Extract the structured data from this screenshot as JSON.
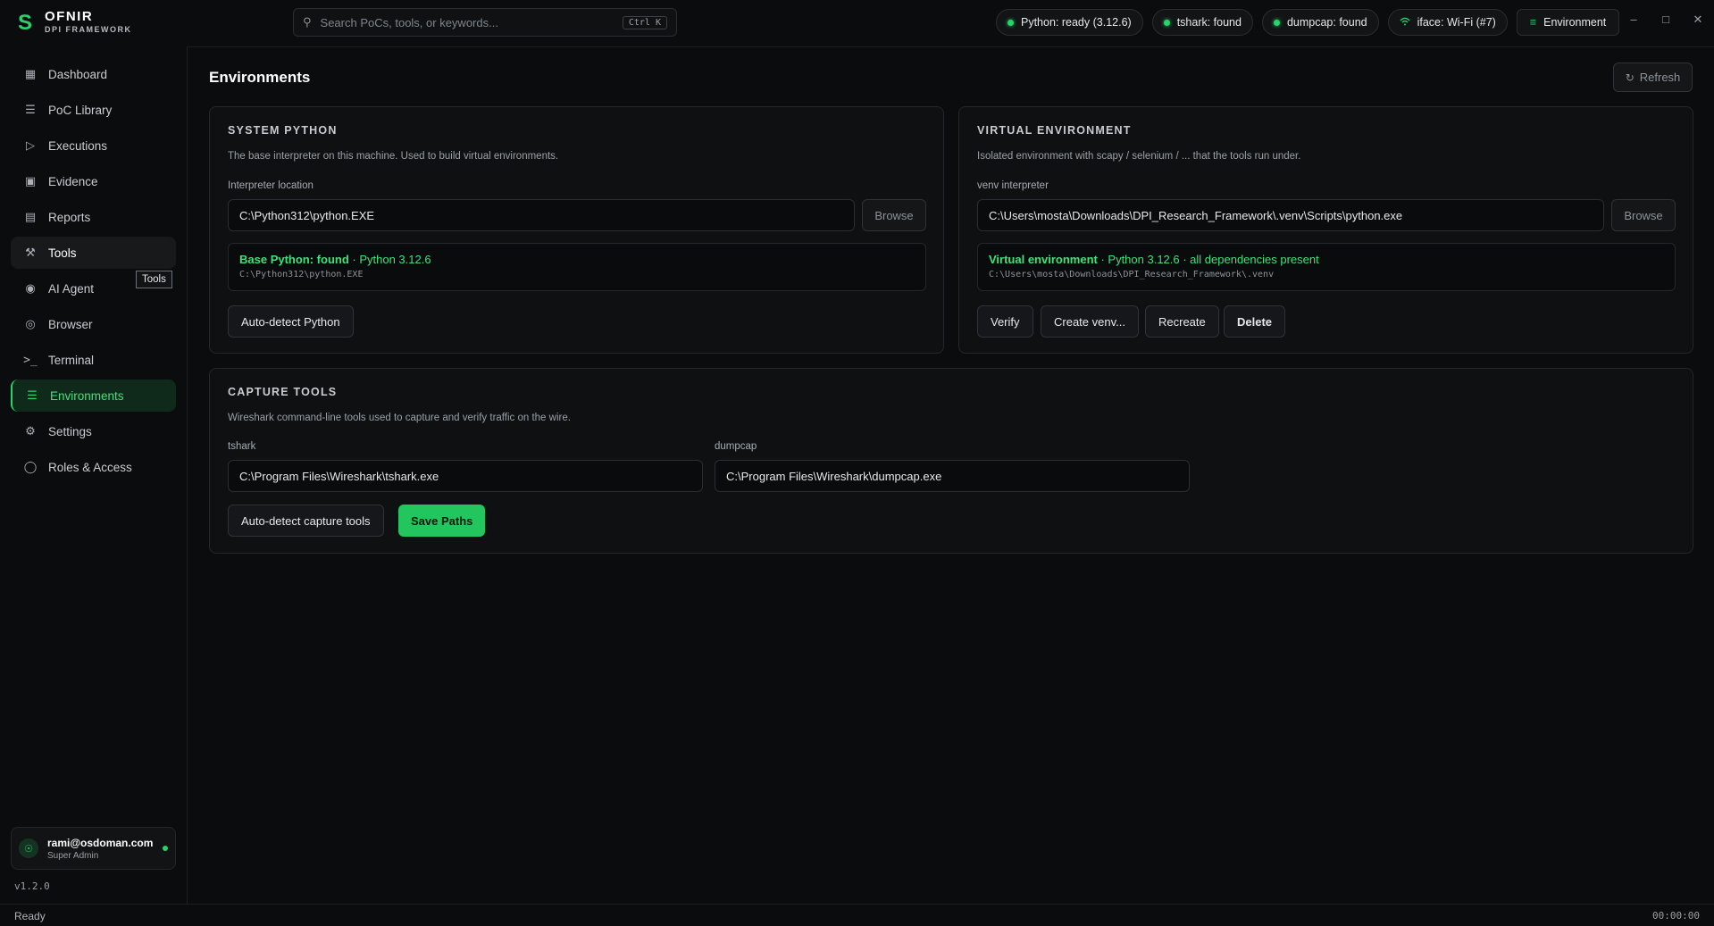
{
  "app": {
    "logo_mark": "S",
    "title": "OFNIR",
    "subtitle": "DPI FRAMEWORK"
  },
  "search": {
    "placeholder": "Search PoCs, tools, or keywords...",
    "shortcut": "Ctrl K"
  },
  "status_pills": [
    {
      "label": "Python: ready (3.12.6)"
    },
    {
      "label": "tshark: found"
    },
    {
      "label": "dumpcap: found"
    },
    {
      "label": "iface: Wi-Fi (#7)"
    }
  ],
  "env_button": "Environment",
  "window_controls": {
    "minimize": "–",
    "maximize": "□",
    "close": "✕"
  },
  "sidebar": {
    "items": [
      {
        "label": "Dashboard"
      },
      {
        "label": "PoC Library"
      },
      {
        "label": "Executions"
      },
      {
        "label": "Evidence"
      },
      {
        "label": "Reports"
      },
      {
        "label": "Tools"
      },
      {
        "label": "AI Agent"
      },
      {
        "label": "Browser"
      },
      {
        "label": "Terminal"
      },
      {
        "label": "Environments"
      },
      {
        "label": "Settings"
      },
      {
        "label": "Roles & Access"
      }
    ],
    "tooltip": "Tools",
    "user": {
      "email": "rami@osdoman.com",
      "role": "Super Admin"
    },
    "version": "v1.2.0"
  },
  "main": {
    "title": "Environments",
    "refresh_label": "Refresh",
    "system_python": {
      "title": "SYSTEM PYTHON",
      "description": "The base interpreter on this machine. Used to build virtual environments.",
      "field_label": "Interpreter location",
      "value": "C:\\Python312\\python.EXE",
      "browse_label": "Browse",
      "status_strong": "Base Python: found",
      "status_rest": " · Python 3.12.6",
      "status_path": "C:\\Python312\\python.EXE",
      "autodetect_label": "Auto-detect Python"
    },
    "venv": {
      "title": "VIRTUAL ENVIRONMENT",
      "description": "Isolated environment with scapy / selenium / ... that the tools run under.",
      "field_label": "venv interpreter",
      "value": "C:\\Users\\mosta\\Downloads\\DPI_Research_Framework\\.venv\\Scripts\\python.exe",
      "browse_label": "Browse",
      "status_strong": "Virtual environment",
      "status_rest": " · Python 3.12.6 · all dependencies present",
      "status_path": "C:\\Users\\mosta\\Downloads\\DPI_Research_Framework\\.venv",
      "verify_label": "Verify",
      "create_label": "Create venv...",
      "recreate_label": "Recreate",
      "delete_label": "Delete"
    },
    "capture": {
      "title": "CAPTURE TOOLS",
      "description": "Wireshark command-line tools used to capture and verify traffic on the wire.",
      "tshark_label": "tshark",
      "tshark_value": "C:\\Program Files\\Wireshark\\tshark.exe",
      "dumpcap_label": "dumpcap",
      "dumpcap_value": "C:\\Program Files\\Wireshark\\dumpcap.exe",
      "autodetect_label": "Auto-detect capture tools",
      "save_label": "Save Paths"
    }
  },
  "statusbar": {
    "left": "Ready",
    "right": "00:00:00"
  },
  "colors": {
    "accent": "#22c55e",
    "background": "#0b0c0d",
    "panel": "#0e1012"
  }
}
